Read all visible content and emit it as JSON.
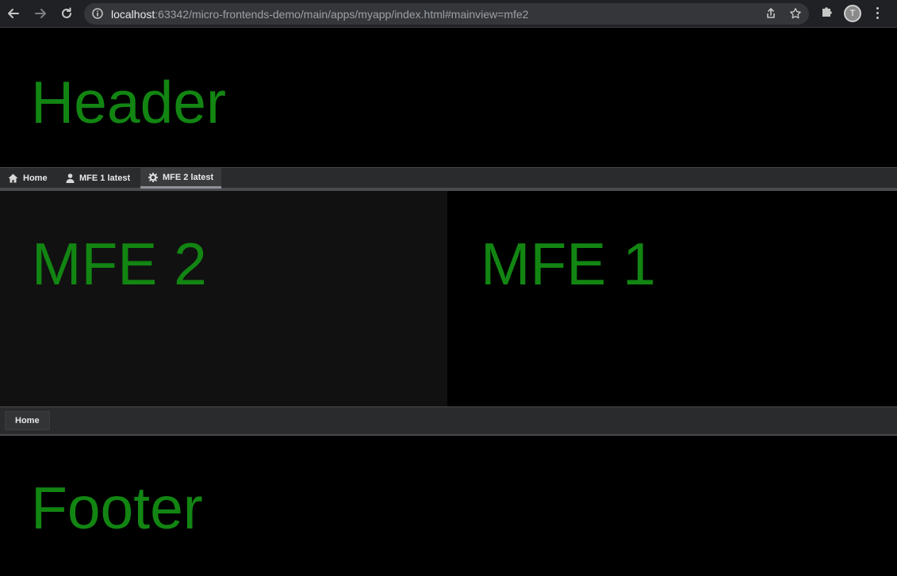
{
  "browser": {
    "url_host": "localhost",
    "url_rest": ":63342/micro-frontends-demo/main/apps/myapp/index.html#mainview=mfe2",
    "profile_initial": "T",
    "icons": {
      "back": "arrow-left-icon",
      "forward": "arrow-right-icon",
      "reload": "reload-icon",
      "info": "info-icon",
      "share": "share-icon",
      "bookmark": "star-icon",
      "extensions": "puzzle-icon",
      "menu": "kebab-menu-icon"
    }
  },
  "header": {
    "title": "Header"
  },
  "menubar": {
    "tabs": [
      {
        "label": "Home",
        "icon": "home-icon",
        "active": false
      },
      {
        "label": "MFE 1 latest",
        "icon": "user-icon",
        "active": false
      },
      {
        "label": "MFE 2 latest",
        "icon": "gear-icon",
        "active": true
      }
    ]
  },
  "main": {
    "left_title": "MFE 2",
    "right_title": "MFE 1"
  },
  "footer_bar": {
    "home_label": "Home"
  },
  "footer": {
    "title": "Footer"
  },
  "colors": {
    "accent_green": "#128512",
    "chrome_bg": "#202124",
    "left_pane_bg": "#111111"
  }
}
